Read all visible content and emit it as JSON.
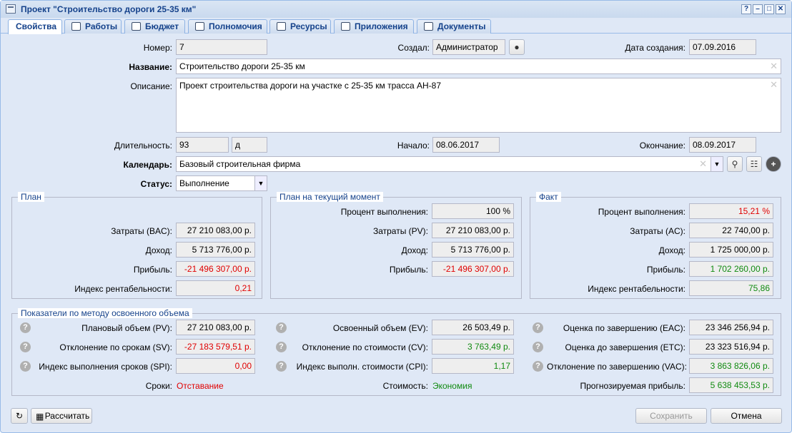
{
  "window": {
    "title": "Проект \"Строительство дороги 25-35 км\"",
    "btn_help": "?",
    "btn_min": "–",
    "btn_max": "□",
    "btn_close": "✕"
  },
  "tabs": [
    "Свойства",
    "Работы",
    "Бюджет",
    "Полномочия",
    "Ресурсы",
    "Приложения",
    "Документы"
  ],
  "header": {
    "number_label": "Номер:",
    "number": "7",
    "created_by_label": "Создал:",
    "created_by": "Администратор",
    "created_date_label": "Дата создания:",
    "created_date": "07.09.2016",
    "name_label": "Название:",
    "name": "Строительство дороги 25-35 км",
    "desc_label": "Описание:",
    "desc": "Проект строительства дороги на участке с 25-35 км трасса АН-87",
    "duration_label": "Длительность:",
    "duration": "93",
    "duration_unit": "д",
    "start_label": "Начало:",
    "start": "08.06.2017",
    "end_label": "Окончание:",
    "end": "08.09.2017",
    "calendar_label": "Календарь:",
    "calendar": "Базовый строительная фирма",
    "status_label": "Статус:",
    "status": "Выполнение"
  },
  "plan": {
    "legend": "План",
    "cost_label": "Затраты (BAC):",
    "cost": "27 210 083,00 р.",
    "income_label": "Доход:",
    "income": "5 713 776,00 р.",
    "profit_label": "Прибыль:",
    "profit": "-21 496 307,00 р.",
    "index_label": "Индекс рентабельности:",
    "index": "0,21"
  },
  "current": {
    "legend": "План на текущий момент",
    "pct_label": "Процент выполнения:",
    "pct": "100 %",
    "cost_label": "Затраты (PV):",
    "cost": "27 210 083,00 р.",
    "income_label": "Доход:",
    "income": "5 713 776,00 р.",
    "profit_label": "Прибыль:",
    "profit": "-21 496 307,00 р."
  },
  "fact": {
    "legend": "Факт",
    "pct_label": "Процент выполнения:",
    "pct": "15,21 %",
    "cost_label": "Затраты (AC):",
    "cost": "22 740,00 р.",
    "income_label": "Доход:",
    "income": "1 725 000,00 р.",
    "profit_label": "Прибыль:",
    "profit": "1 702 260,00 р.",
    "index_label": "Индекс рентабельности:",
    "index": "75,86"
  },
  "evm": {
    "legend": "Показатели по методу освоенного объема",
    "pv_label": "Плановый объем (PV):",
    "pv": "27 210 083,00 р.",
    "sv_label": "Отклонение по срокам (SV):",
    "sv": "-27 183 579,51 р.",
    "spi_label": "Индекс выполнения сроков (SPI):",
    "spi": "0,00",
    "ev_label": "Освоенный объем (EV):",
    "ev": "26 503,49 р.",
    "cv_label": "Отклонение по стоимости (CV):",
    "cv": "3 763,49 р.",
    "cpi_label": "Индекс выполн. стоимости (CPI):",
    "cpi": "1,17",
    "eac_label": "Оценка по завершению (EAC):",
    "eac": "23 346 256,94 р.",
    "etc_label": "Оценка до завершения (ETC):",
    "etc": "23 323 516,94 р.",
    "vac_label": "Отклонение по завершению (VAC):",
    "vac": "3 863 826,06 р.",
    "terms_label": "Сроки:",
    "terms": "Отставание",
    "cost_status_label": "Стоимость:",
    "cost_status": "Экономия",
    "forecast_label": "Прогнозируемая прибыль:",
    "forecast": "5 638 453,53 р.",
    "help": "?"
  },
  "footer": {
    "calculate": "Рассчитать",
    "save": "Сохранить",
    "cancel": "Отмена"
  },
  "colors": {
    "negative": "#e00000",
    "positive": "#108a10",
    "accent": "#15428b"
  }
}
